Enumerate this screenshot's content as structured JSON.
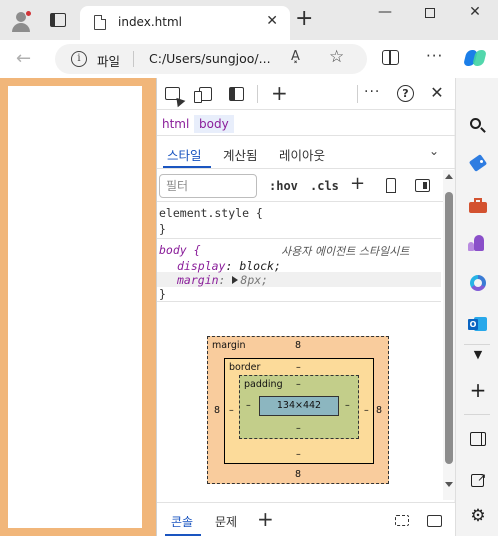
{
  "titlebar": {
    "tab_title": "index.html",
    "tab_close": "✕",
    "new_tab": "+",
    "minimize": "—",
    "close": "✕"
  },
  "navbar": {
    "back": "←",
    "info": "i",
    "scheme_label": "파일",
    "url": "C:/Users/sungjoo/...",
    "read_aloud": "A͓",
    "favorite": "☆",
    "more": "···"
  },
  "devtools": {
    "toolbar": {
      "add_tool": "+",
      "more": "···",
      "help": "?",
      "close": "✕"
    },
    "breadcrumbs": [
      "html",
      "body"
    ],
    "subtabs": {
      "styles": "스타일",
      "computed": "계산됨",
      "layout": "레이아웃",
      "chevron": "⌄"
    },
    "filter": {
      "placeholder": "필터",
      "hov": ":hov",
      "cls": ".cls",
      "new_rule": "+"
    },
    "rules": {
      "element_style_open": "element.style {",
      "element_style_close": "}",
      "body_selector": "body {",
      "body_source": "사용자 에이전트 스타일시트",
      "decl1_prop": "display",
      "decl1_val": "block;",
      "decl2_prop": "margin",
      "decl2_val": "8px;",
      "body_close": "}"
    },
    "box_model": {
      "margin_label": "margin",
      "margin_top": "8",
      "margin_right": "8",
      "margin_bottom": "8",
      "margin_left": "8",
      "border_label": "border",
      "border_top": "–",
      "border_right": "–",
      "border_bottom": "–",
      "border_left": "–",
      "padding_label": "padding",
      "padding_top": "–",
      "padding_right": "–",
      "padding_bottom": "–",
      "padding_left": "–",
      "content": "134×442"
    },
    "drawer": {
      "console": "콘솔",
      "issues": "문제",
      "add": "+"
    }
  },
  "edge_sidebar": {
    "dropdown": "▼",
    "add": "+",
    "settings": "⚙"
  },
  "colors": {
    "margin": "#f9cc9d",
    "border": "#fcdb9a",
    "padding": "#c3ce8a",
    "content": "#8cb6c0",
    "page_margin_highlight": "#f1b67a",
    "accent": "#1a55c0"
  }
}
